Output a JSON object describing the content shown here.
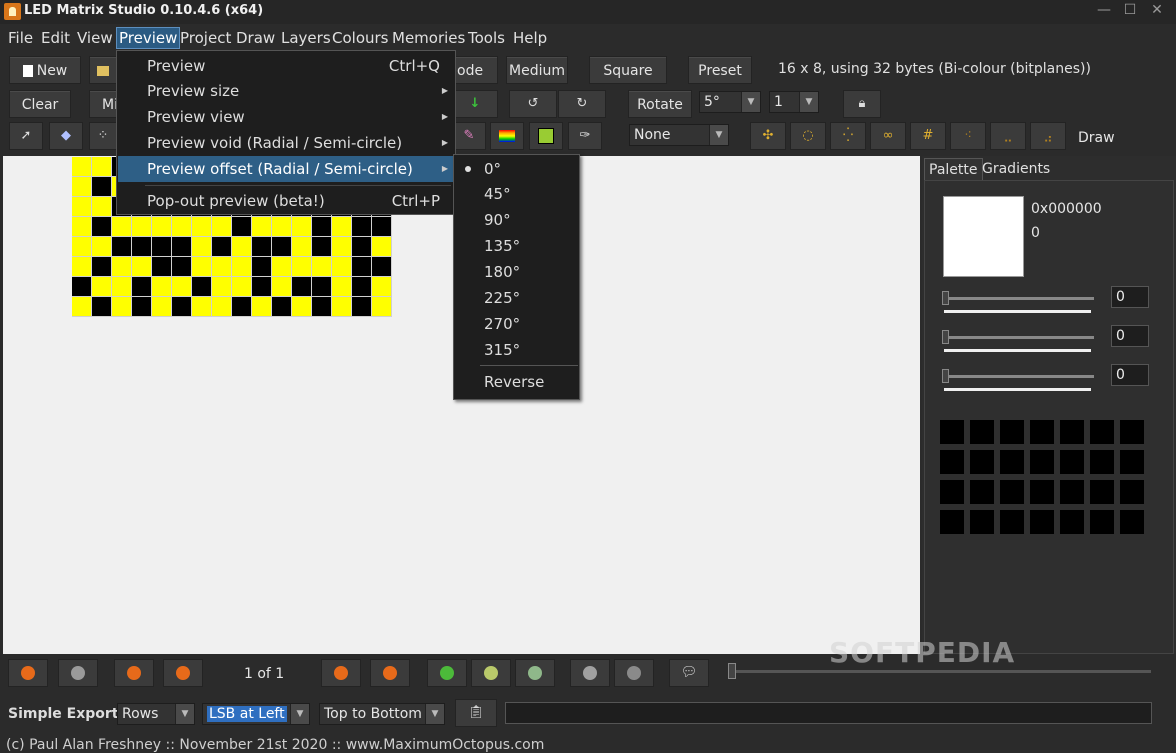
{
  "window": {
    "title": "LED Matrix Studio 0.10.4.6 (x64)",
    "min": "—",
    "max": "☐",
    "close": "✕"
  },
  "menu": [
    "File",
    "Edit",
    "View",
    "Preview",
    "Project",
    "Draw",
    "Layers",
    "Colours",
    "Memories",
    "Tools",
    "Help"
  ],
  "toolbar1": {
    "new": "New",
    "mode_partial": "ode",
    "medium": "Medium",
    "square": "Square",
    "preset": "Preset",
    "status": "16 x 8, using 32 bytes (Bi-colour (bitplanes))"
  },
  "toolbar2": {
    "clear": "Clear",
    "mirror_partial": "Mi",
    "rotate": "Rotate",
    "angle": "5°",
    "count": "1"
  },
  "toolbar3": {
    "none": "None",
    "draw": "Draw"
  },
  "preview_menu": {
    "items": [
      {
        "label": "Preview",
        "shortcut": "Ctrl+Q"
      },
      {
        "label": "Preview size",
        "sub": "▶"
      },
      {
        "label": "Preview view",
        "sub": "▶"
      },
      {
        "label": "Preview void (Radial / Semi-circle)",
        "sub": "▶"
      },
      {
        "label": "Preview offset (Radial / Semi-circle)",
        "sub": "▶"
      },
      {
        "label": "Pop-out preview (beta!)",
        "shortcut": "Ctrl+P"
      }
    ]
  },
  "offset_submenu": {
    "items": [
      "0°",
      "45°",
      "90°",
      "135°",
      "180°",
      "225°",
      "270°",
      "315°"
    ],
    "reverse": "Reverse",
    "selected": "0°"
  },
  "panel": {
    "tabs": [
      "Palette",
      "Gradients"
    ],
    "hex": "0x000000",
    "value": "0",
    "sliders": [
      "0",
      "0",
      "0"
    ]
  },
  "playback": {
    "page": "1 of 1"
  },
  "export": {
    "label": "Simple Export",
    "rows": "Rows",
    "lsb": "LSB at Left",
    "order": "Top to Bottom"
  },
  "footer": "(c) Paul Alan Freshney :: November 21st 2020 :: www.MaximumOctopus.com",
  "watermark": "SOFTPEDIA",
  "matrix": [
    "yy..............",
    "y.y.............",
    "yy..............",
    "y.yyyyyy.yyy.y..",
    "yy....y.y..y.y.y",
    "y.yy..yyy.yyyy..",
    ".yy.yy.yy.y..y.y",
    "y.y.y.yy.y.y.y.y"
  ],
  "colors": {
    "on": "#ffff00",
    "off": "#000000",
    "accent": "#2b5b83"
  }
}
